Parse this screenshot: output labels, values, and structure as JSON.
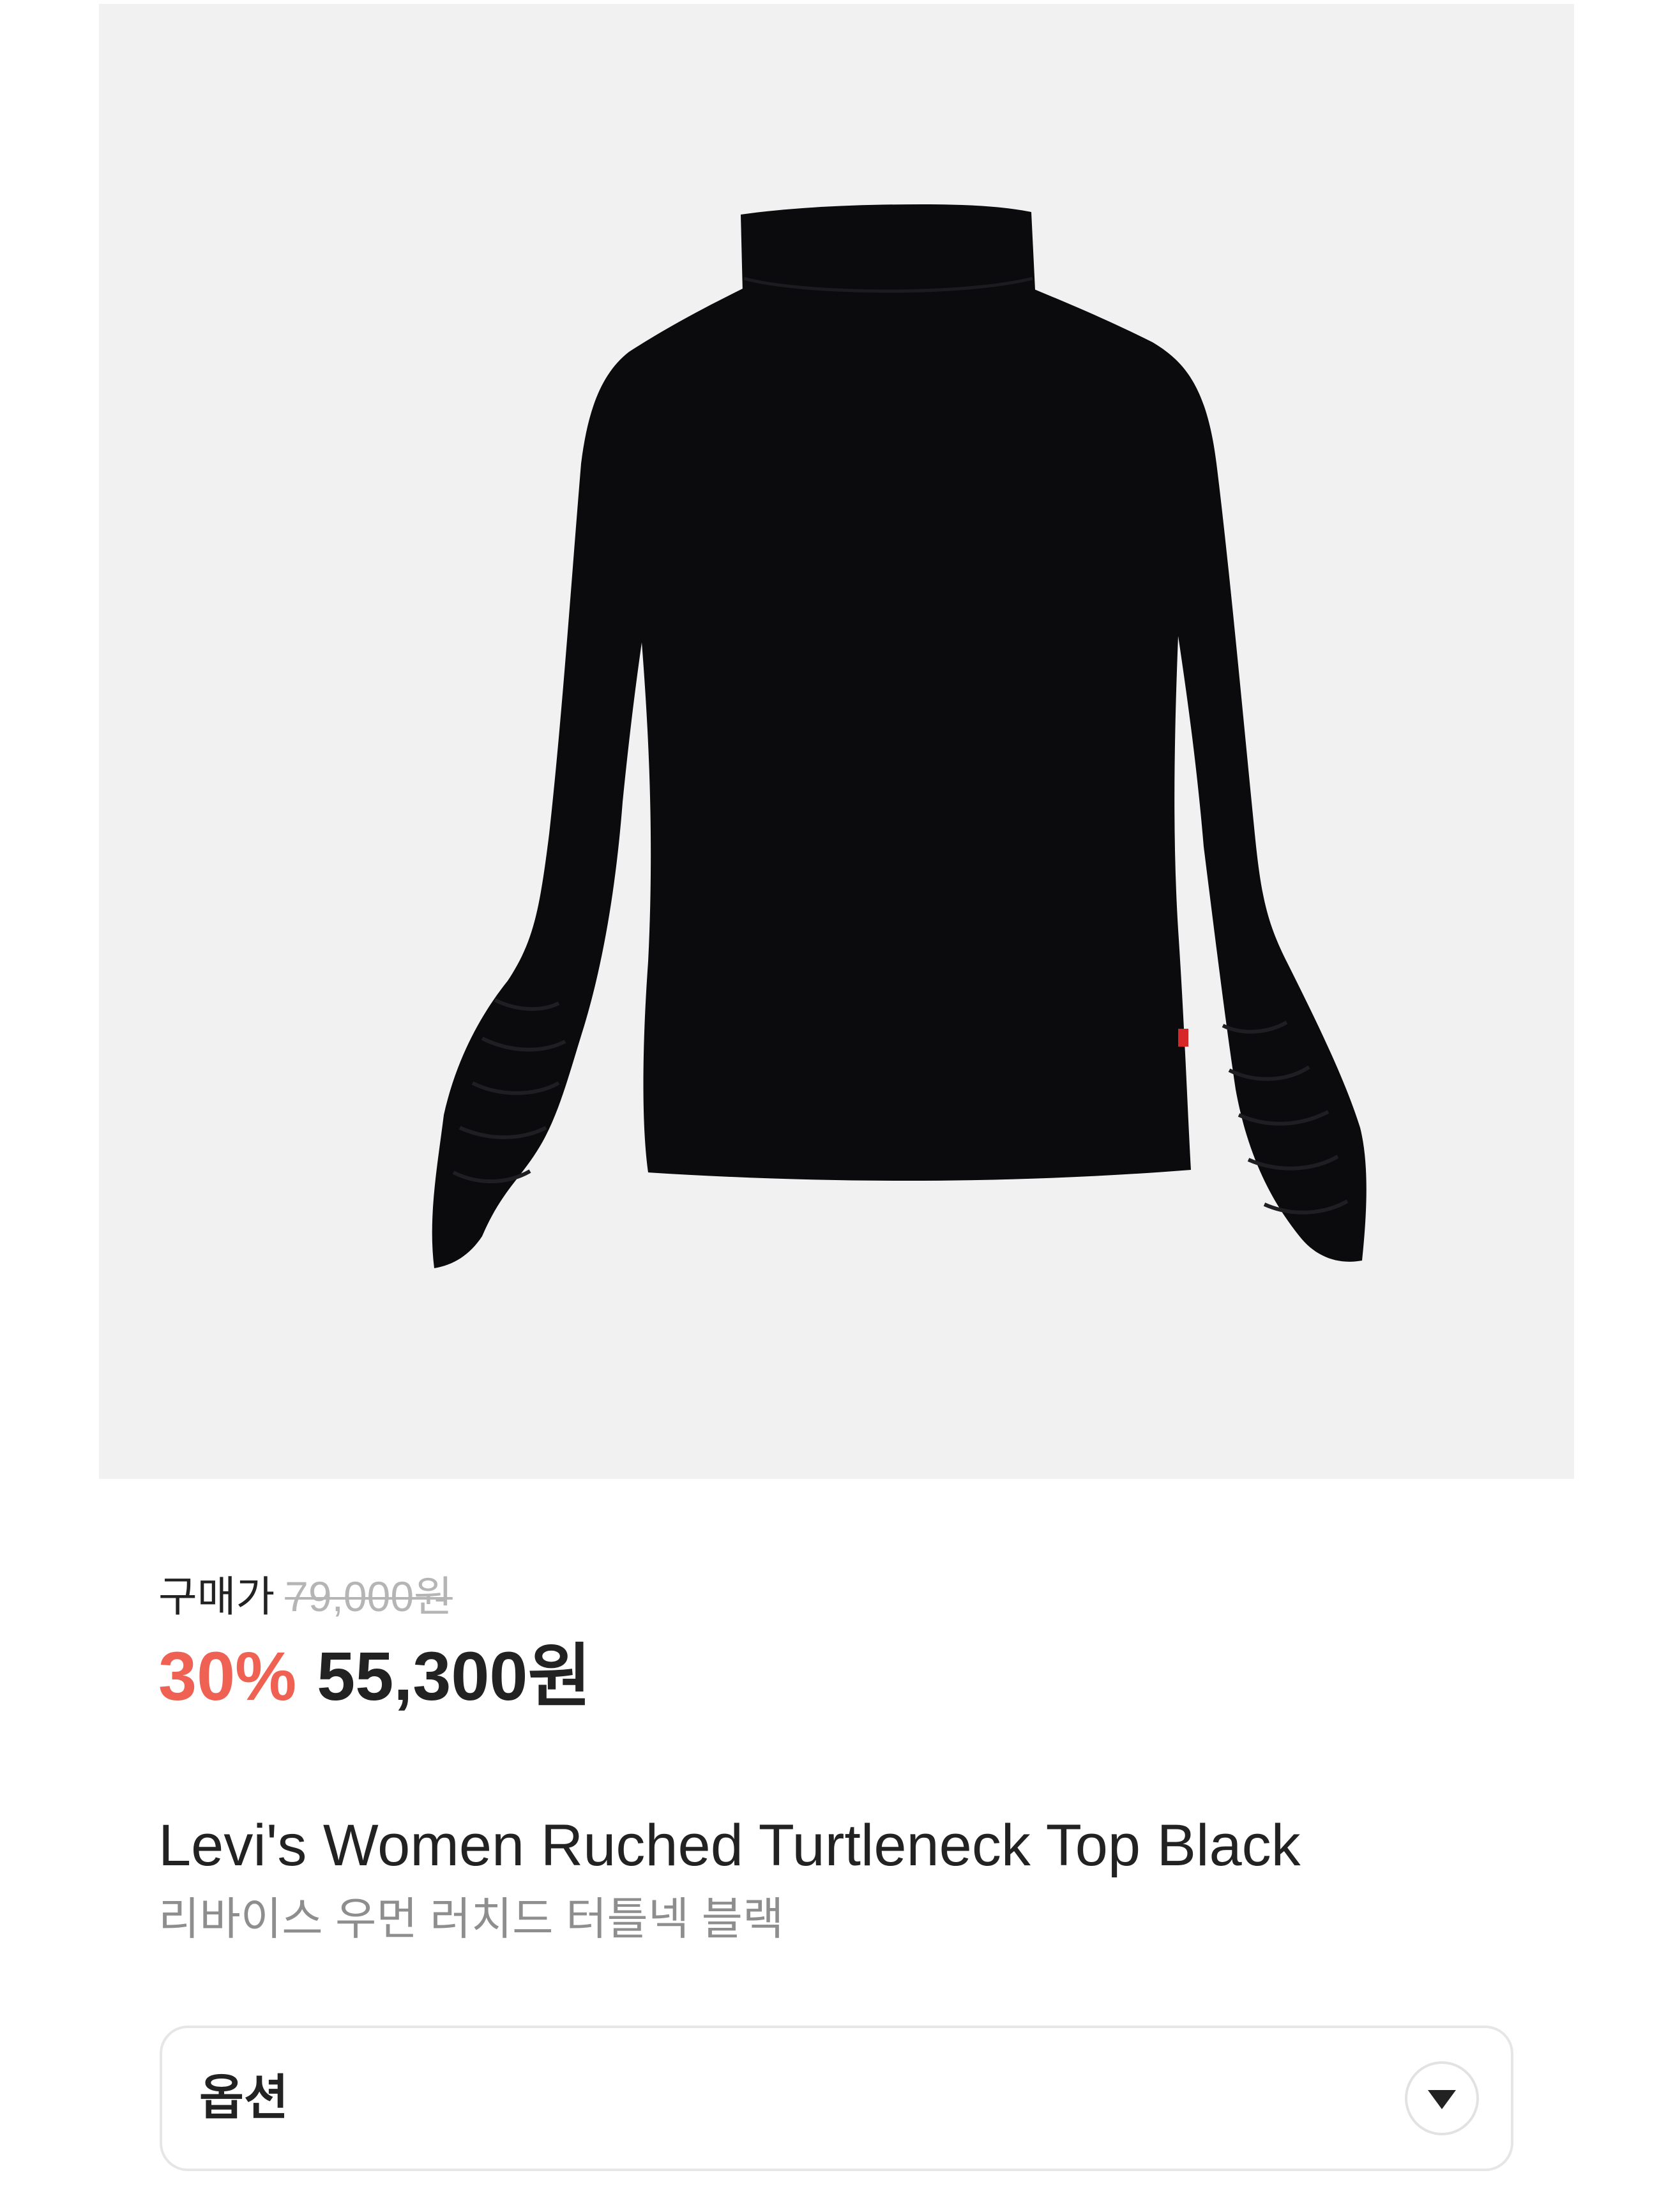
{
  "product": {
    "image_icon": "black-ruched-turtleneck-top-photo",
    "price_label": "구매가",
    "original_price": "79,000원",
    "discount_rate": "30%",
    "sale_price": "55,300원",
    "name_en": "Levi's Women Ruched Turtleneck Top Black",
    "name_ko": "리바이스 우먼 러치드 터틀넥 블랙"
  },
  "option": {
    "label": "옵션",
    "toggle_icon": "chevron-down-icon"
  },
  "colors": {
    "image_background": "#f1f1f1",
    "garment": "#0b0b0d",
    "discount": "#ef6253",
    "text_primary": "#222222",
    "text_secondary": "#8e8e8e",
    "text_strikethrough": "#b5b5b5",
    "border": "#e6e6e6"
  }
}
